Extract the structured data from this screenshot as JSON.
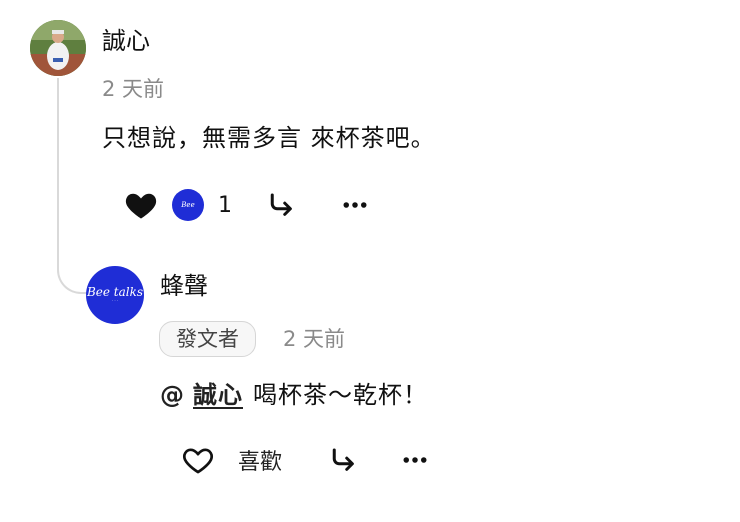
{
  "comment": {
    "author": "誠心",
    "time": "2 天前",
    "text": "只想說，無需多言 來杯茶吧。",
    "like_count": "1",
    "icons": {
      "like": "heart-filled-icon",
      "reactor": "reactor-avatar",
      "reply": "reply-arrow-icon",
      "more": "more-dots-icon"
    }
  },
  "reply": {
    "author": "蜂聲",
    "badge": "發文者",
    "time": "2 天前",
    "at": "@",
    "mention": "誠心",
    "text": "喝杯茶～乾杯！",
    "like_label": "喜歡",
    "icons": {
      "like": "heart-outline-icon",
      "reply": "reply-arrow-icon",
      "more": "more-dots-icon"
    }
  },
  "colors": {
    "brand_blue": "#1f2dd6",
    "muted_text": "#8a8a8a",
    "thread_line": "#d9d9d9"
  }
}
